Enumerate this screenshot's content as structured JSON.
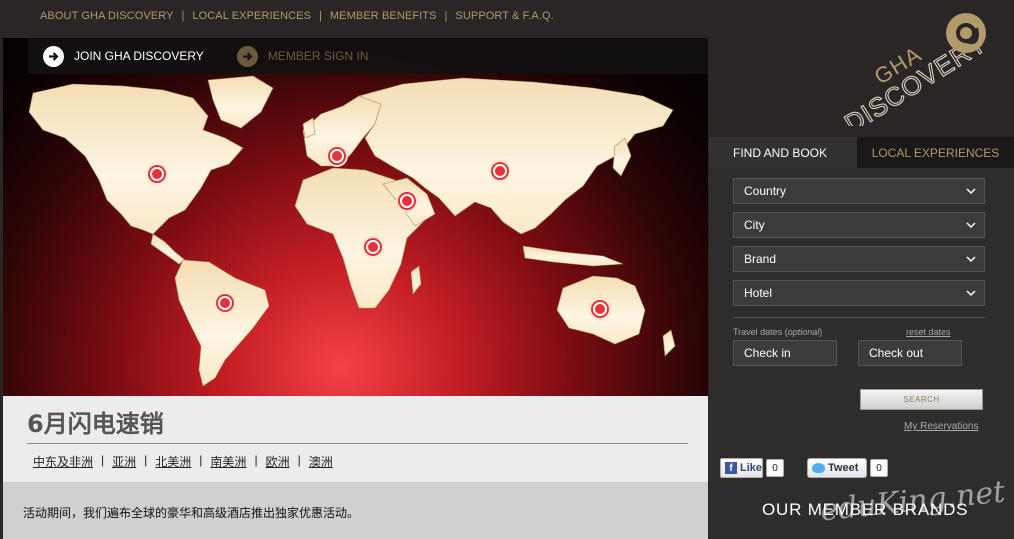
{
  "topnav": {
    "items": [
      "ABOUT GHA DISCOVERY",
      "LOCAL EXPERIENCES",
      "MEMBER BENEFITS",
      "SUPPORT & F.A.Q."
    ],
    "separator": "|"
  },
  "logo": {
    "line1": "GHA",
    "line2": "DISCOVERY"
  },
  "join_bar": {
    "join_label": "JOIN GHA DISCOVERY",
    "signin_label": "MEMBER SIGN IN"
  },
  "promo": {
    "title": "6月闪电速销",
    "regions": [
      "中东及非洲",
      "亚洲",
      "北美洲",
      "南美洲",
      "欧洲",
      "澳洲"
    ],
    "separator": "|",
    "description": "活动期间，我们遍布全球的豪华和高级酒店推出独家优惠活动。"
  },
  "booking": {
    "tab_find": "FIND AND BOOK",
    "tab_local": "LOCAL EXPERIENCES",
    "country": "Country",
    "city": "City",
    "brand": "Brand",
    "hotel": "Hotel",
    "travel_label": "Travel dates (",
    "travel_optional": "optional",
    "travel_close": ")",
    "reset": "reset dates",
    "checkin": "Check in",
    "checkout": "Check out",
    "search": "SEARCH",
    "my_reservations": "My Reservations"
  },
  "social": {
    "like": "Like",
    "like_count": "0",
    "tweet": "Tweet",
    "tweet_count": "0"
  },
  "brands_heading": "OUR MEMBER BRANDS",
  "watermark": "eduKing.net",
  "colors": {
    "gold": "#b39a6a",
    "pin_red": "#e53138",
    "panel": "#2f2c2c"
  }
}
